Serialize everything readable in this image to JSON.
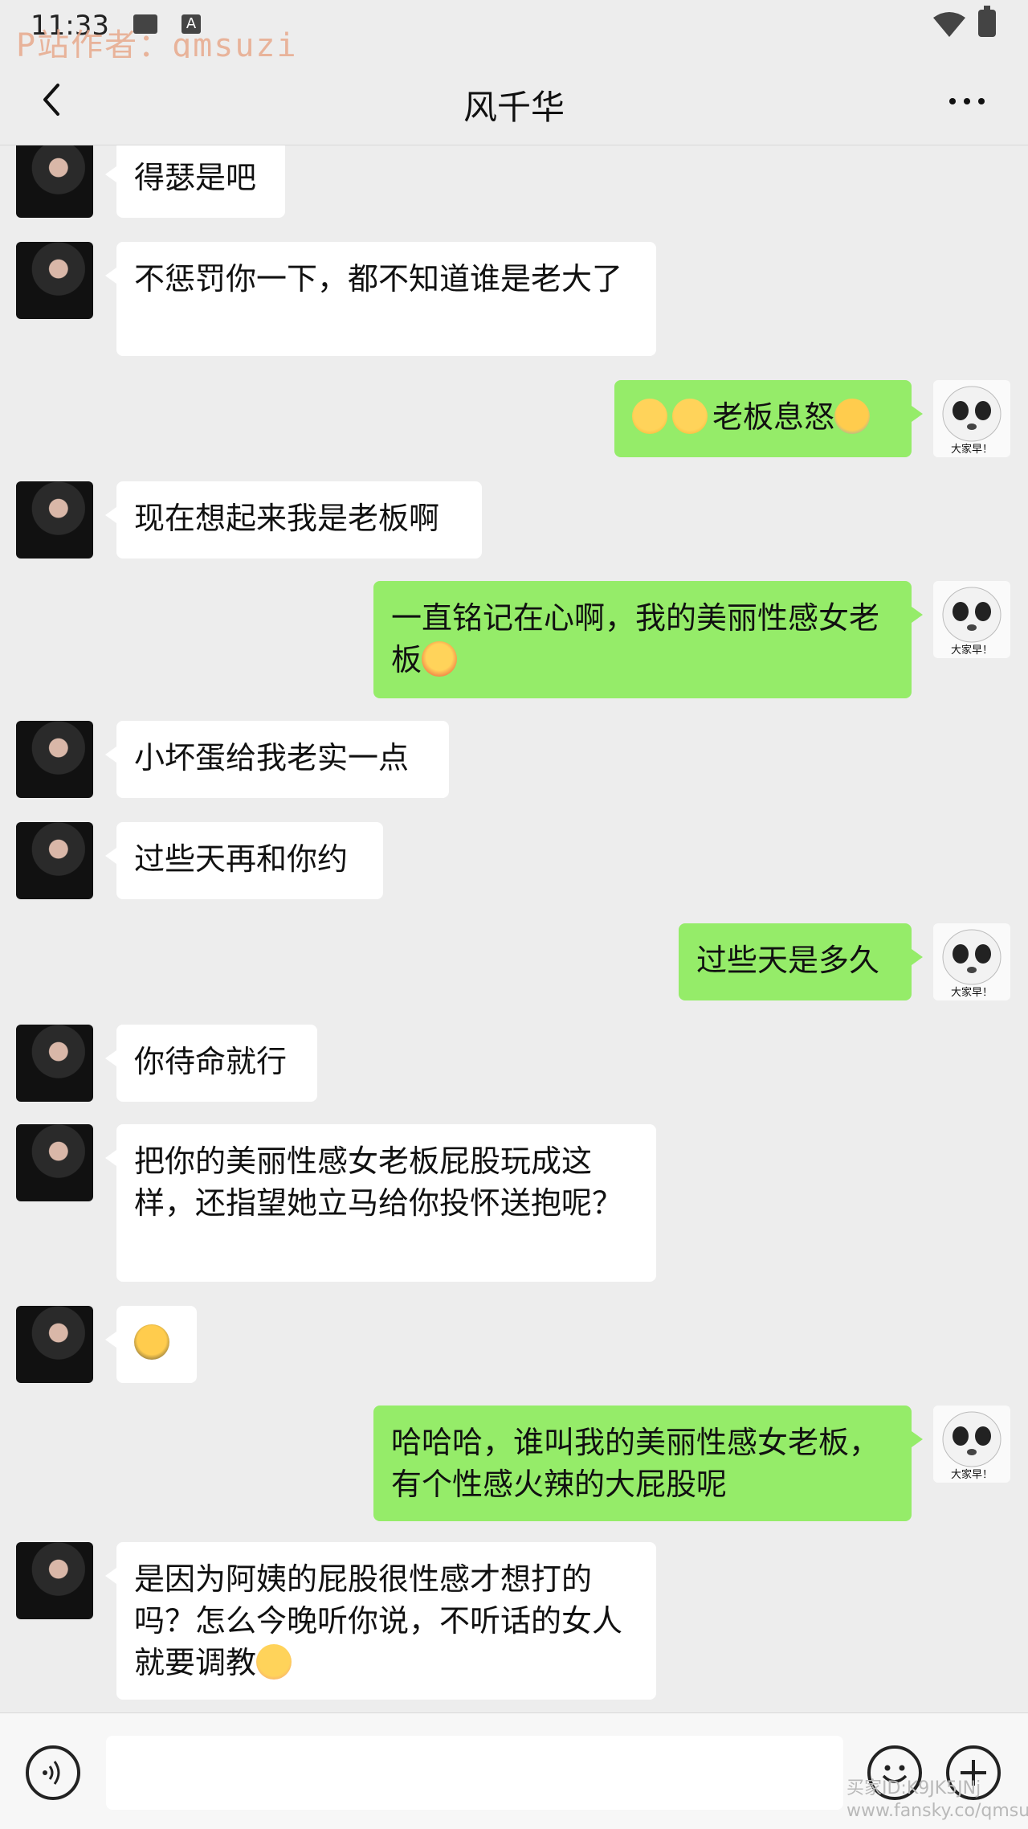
{
  "status_bar": {
    "time": "11:33",
    "a_icon_label": "A",
    "watermark": "P站作者：qmsuzi"
  },
  "header": {
    "title": "风千华"
  },
  "messages": [
    {
      "side": "left",
      "text": "得瑟是吧"
    },
    {
      "side": "left",
      "text": "不惩罚你一下，都不知道谁是老大了"
    },
    {
      "side": "right",
      "text": "老板息怒",
      "emojis_before": [
        "blush-emoji",
        "blush-emoji"
      ],
      "emojis_after": [
        "facepalm-emoji"
      ]
    },
    {
      "side": "left",
      "text": "现在想起来我是老板啊"
    },
    {
      "side": "right",
      "text": "一直铭记在心啊，我的美丽性感女老板",
      "emojis_after": [
        "heart-eyes-emoji"
      ]
    },
    {
      "side": "left",
      "text": "小坏蛋给我老实一点"
    },
    {
      "side": "left",
      "text": "过些天再和你约"
    },
    {
      "side": "right",
      "text": "过些天是多久"
    },
    {
      "side": "left",
      "text": "你待命就行"
    },
    {
      "side": "left",
      "text": "把你的美丽性感女老板屁股玩成这样，还指望她立马给你投怀送抱呢？"
    },
    {
      "side": "left",
      "text": "",
      "emojis_after": [
        "grimace-emoji"
      ]
    },
    {
      "side": "right",
      "text": "哈哈哈，谁叫我的美丽性感女老板，有个性感火辣的大屁股呢"
    },
    {
      "side": "left",
      "text": "是因为阿姨的屁股很性感才想打的吗？怎么今晚听你说，不听话的女人就要调教",
      "emojis_after": [
        "flushed-emoji"
      ]
    }
  ],
  "avatar_right_caption": "大家早！",
  "watermark_bottom": {
    "line1": "买家ID:K9JK5JNj",
    "line2": "www.fansky.co/qmsuzi"
  },
  "colors": {
    "bg": "#ededed",
    "bubble_self": "#95ec69",
    "bubble_other": "#ffffff"
  }
}
